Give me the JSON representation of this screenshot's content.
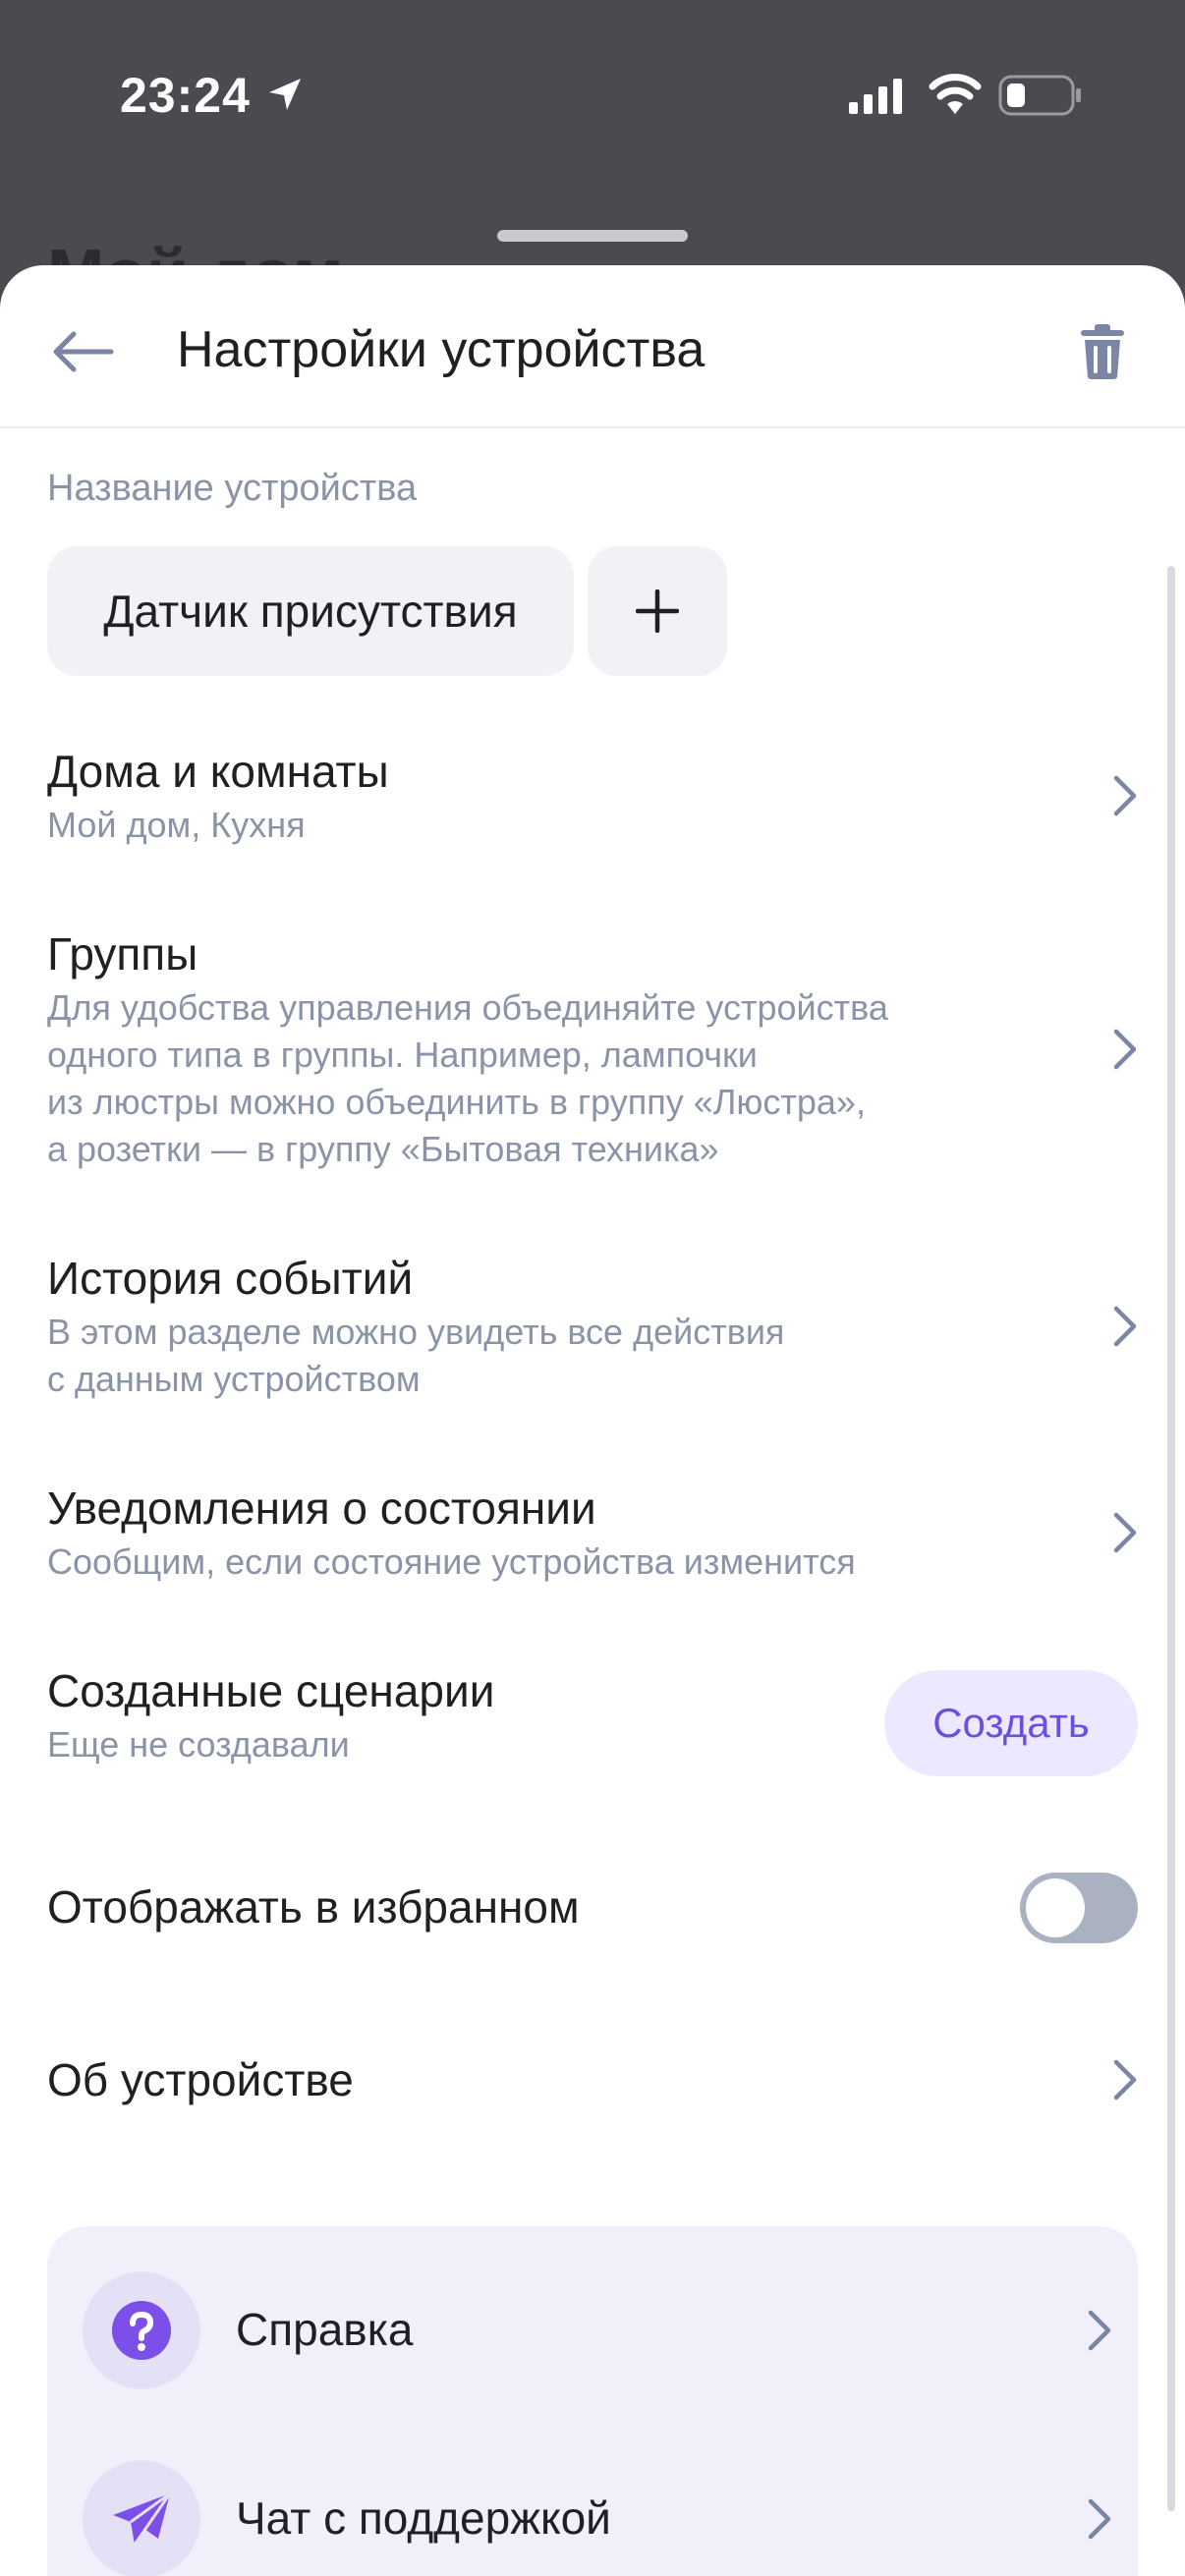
{
  "status_bar": {
    "time": "23:24"
  },
  "background": {
    "title": "Мой дом"
  },
  "header": {
    "title": "Настройки устройства"
  },
  "device_name": {
    "label": "Название устройства",
    "value": "Датчик присутствия"
  },
  "rows": [
    {
      "title": "Дома и комнаты",
      "subtitle": "Мой дом, Кухня"
    },
    {
      "title": "Группы",
      "subtitle_lines": [
        "Для удобства управления объединяйте устройства",
        "одного типа в группы. Например, лампочки",
        "из люстры можно объединить в группу «Люстра»,",
        "а розетки — в группу «Бытовая техника»"
      ]
    },
    {
      "title": "История событий",
      "subtitle_lines": [
        "В этом разделе можно увидеть все действия",
        "с данным устройством"
      ]
    },
    {
      "title": "Уведомления о состоянии",
      "subtitle": "Сообщим, если состояние устройства изменится"
    }
  ],
  "scenarios": {
    "title": "Созданные сценарии",
    "subtitle": "Еще не создавали",
    "button": "Создать"
  },
  "favorites": {
    "title": "Отображать в избранном",
    "enabled": false
  },
  "about": {
    "title": "Об устройстве"
  },
  "support": [
    {
      "label": "Справка",
      "icon": "help-icon"
    },
    {
      "label": "Чат с поддержкой",
      "icon": "paper-plane-icon"
    }
  ],
  "colors": {
    "accent": "#6b4fe0",
    "muted": "#8a93a8",
    "sheet": "#ffffff",
    "backdrop": "#4a4b50"
  }
}
